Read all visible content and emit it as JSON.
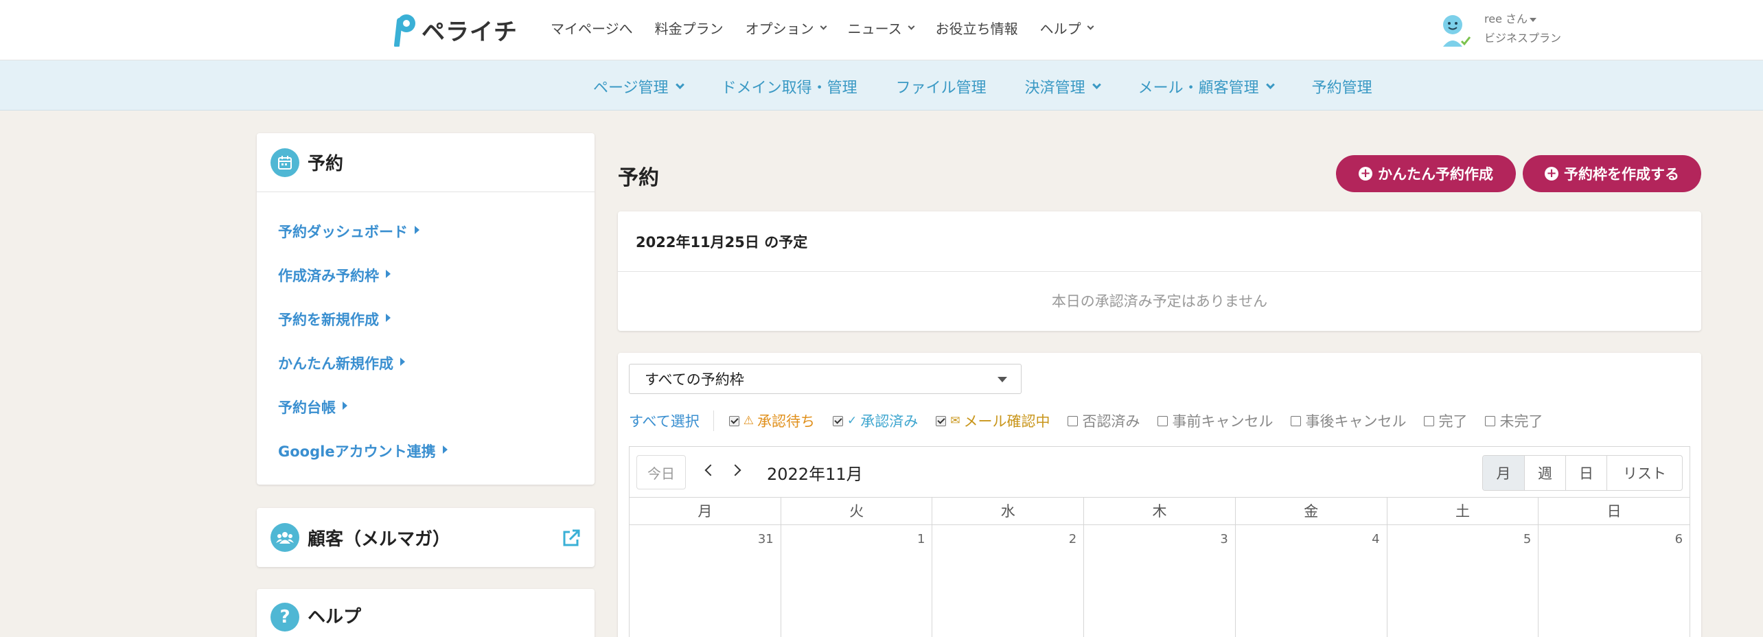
{
  "header": {
    "logo_text": "ペライチ",
    "nav": [
      {
        "label": "マイページへ",
        "dropdown": false
      },
      {
        "label": "料金プラン",
        "dropdown": false
      },
      {
        "label": "オプション",
        "dropdown": true
      },
      {
        "label": "ニュース",
        "dropdown": true
      },
      {
        "label": "お役立ち情報",
        "dropdown": false
      },
      {
        "label": "ヘルプ",
        "dropdown": true
      }
    ],
    "user": {
      "name": "ree さん",
      "plan": "ビジネスプラン"
    }
  },
  "subnav": [
    {
      "label": "ページ管理",
      "dropdown": true
    },
    {
      "label": "ドメイン取得・管理",
      "dropdown": false
    },
    {
      "label": "ファイル管理",
      "dropdown": false
    },
    {
      "label": "決済管理",
      "dropdown": true
    },
    {
      "label": "メール・顧客管理",
      "dropdown": true
    },
    {
      "label": "予約管理",
      "dropdown": false
    }
  ],
  "sidebar": {
    "reservation": {
      "title": "予約",
      "links": [
        "予約ダッシュボード",
        "作成済み予約枠",
        "予約を新規作成",
        "かんたん新規作成",
        "予約台帳",
        "Googleアカウント連携"
      ]
    },
    "customers_title": "顧客（メルマガ）",
    "help_title": "ヘルプ"
  },
  "main": {
    "title": "予約",
    "btn_easy": "かんたん予約作成",
    "btn_slot": "予約枠を作成する",
    "today_header": "2022年11月25日 の予定",
    "today_empty": "本日の承認済み予定はありません",
    "select_value": "すべての予約枠",
    "select_all": "すべて選択",
    "filters": [
      {
        "label": "承認待ち",
        "checked": true,
        "style": "wait",
        "symbol": "⚠"
      },
      {
        "label": "承認済み",
        "checked": true,
        "style": "ok",
        "symbol": "✓"
      },
      {
        "label": "メール確認中",
        "checked": true,
        "style": "mail",
        "symbol": "✉"
      },
      {
        "label": "否認済み",
        "checked": false,
        "style": "gray",
        "symbol": ""
      },
      {
        "label": "事前キャンセル",
        "checked": false,
        "style": "gray",
        "symbol": ""
      },
      {
        "label": "事後キャンセル",
        "checked": false,
        "style": "gray",
        "symbol": ""
      },
      {
        "label": "完了",
        "checked": false,
        "style": "gray",
        "symbol": ""
      },
      {
        "label": "未完了",
        "checked": false,
        "style": "gray",
        "symbol": ""
      }
    ],
    "calendar": {
      "today_label": "今日",
      "month": "2022年11月",
      "views": [
        "月",
        "週",
        "日",
        "リスト"
      ],
      "dow": [
        "月",
        "火",
        "水",
        "木",
        "金",
        "土",
        "日"
      ],
      "first_week": [
        "31",
        "1",
        "2",
        "3",
        "4",
        "5",
        "6"
      ]
    }
  },
  "colors": {
    "accent": "#b3255b",
    "link": "#3a8fd0",
    "subnav_bg": "#e4f1f7",
    "icon": "#4fb7d4"
  }
}
